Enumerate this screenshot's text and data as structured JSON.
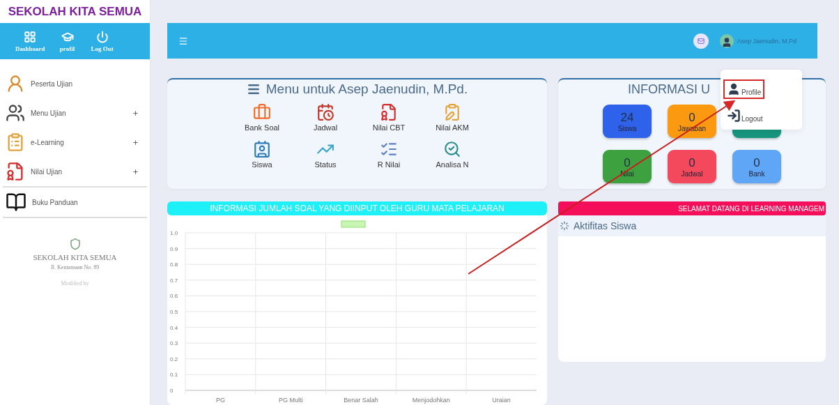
{
  "sidebar": {
    "brand": "SEKOLAH KITA SEMUA",
    "shortcuts": [
      {
        "label": "Dashboard"
      },
      {
        "label": "profil"
      },
      {
        "label": "Log Out"
      }
    ],
    "items": [
      {
        "label": "Peserta Ujian",
        "expandable": false
      },
      {
        "label": "Menu Ujian",
        "expandable": true
      },
      {
        "label": "e-Learning",
        "expandable": true
      },
      {
        "label": "Nilai Ujian",
        "expandable": true
      }
    ],
    "guide_item": {
      "label": "Buku Panduan"
    },
    "footer": {
      "school": "SEKOLAH KITA SEMUA",
      "address": "Jl. Kentamaan No. 89",
      "credit": "Modified by"
    }
  },
  "topbar": {
    "user": "Asep Jaenudin, M.Pd",
    "menu": [
      {
        "label": "Profile",
        "highlighted": true
      },
      {
        "label": "Logout",
        "highlighted": false
      }
    ]
  },
  "menu_card": {
    "title": "Menu untuk Asep Jaenudin, M.Pd.",
    "items": [
      {
        "label": "Bank Soal"
      },
      {
        "label": "Jadwal"
      },
      {
        "label": "Nilai CBT"
      },
      {
        "label": "Nilai AKM"
      },
      {
        "label": "Siswa"
      },
      {
        "label": "Status"
      },
      {
        "label": "R Nilai"
      },
      {
        "label": "Analisa N"
      }
    ]
  },
  "info_card": {
    "title": "INFORMASI U",
    "tiles": [
      {
        "count": "24",
        "label": "Siswa",
        "color": "#2f62ea"
      },
      {
        "count": "0",
        "label": "Jawaban",
        "color": "#fb9a10"
      },
      {
        "color": "#17957f"
      },
      {
        "count": "0",
        "label": "Nilai",
        "color": "#3da140"
      },
      {
        "count": "0",
        "label": "Jadwal",
        "color": "#f4485c"
      },
      {
        "count": "0",
        "label": "Bank",
        "color": "#60a6f7"
      }
    ]
  },
  "chart_card": {
    "title": "INFORMASI JUMLAH SOAL YANG DIINPUT OLEH GURU MATA PELAJARAN",
    "chart_data": {
      "type": "bar",
      "categories": [
        "PG",
        "PG Multi",
        "Benar Salah",
        "Menjodohkan",
        "Uraian"
      ],
      "series": [
        {
          "color": "#c9f5b5",
          "values": [
            null,
            null,
            null,
            null,
            null
          ]
        }
      ],
      "ylim": [
        0,
        1
      ],
      "grid": true,
      "yticks": [
        0,
        0.1,
        0.2,
        0.3,
        0.4,
        0.5,
        0.6,
        0.7,
        0.8,
        0.9,
        {
          "value": 1,
          "label": "1.0"
        }
      ]
    }
  },
  "activity_card": {
    "banner": "SELAMAT DATANG DI LEARNING MANAGEM",
    "title": "Aktifitas Siswa"
  }
}
